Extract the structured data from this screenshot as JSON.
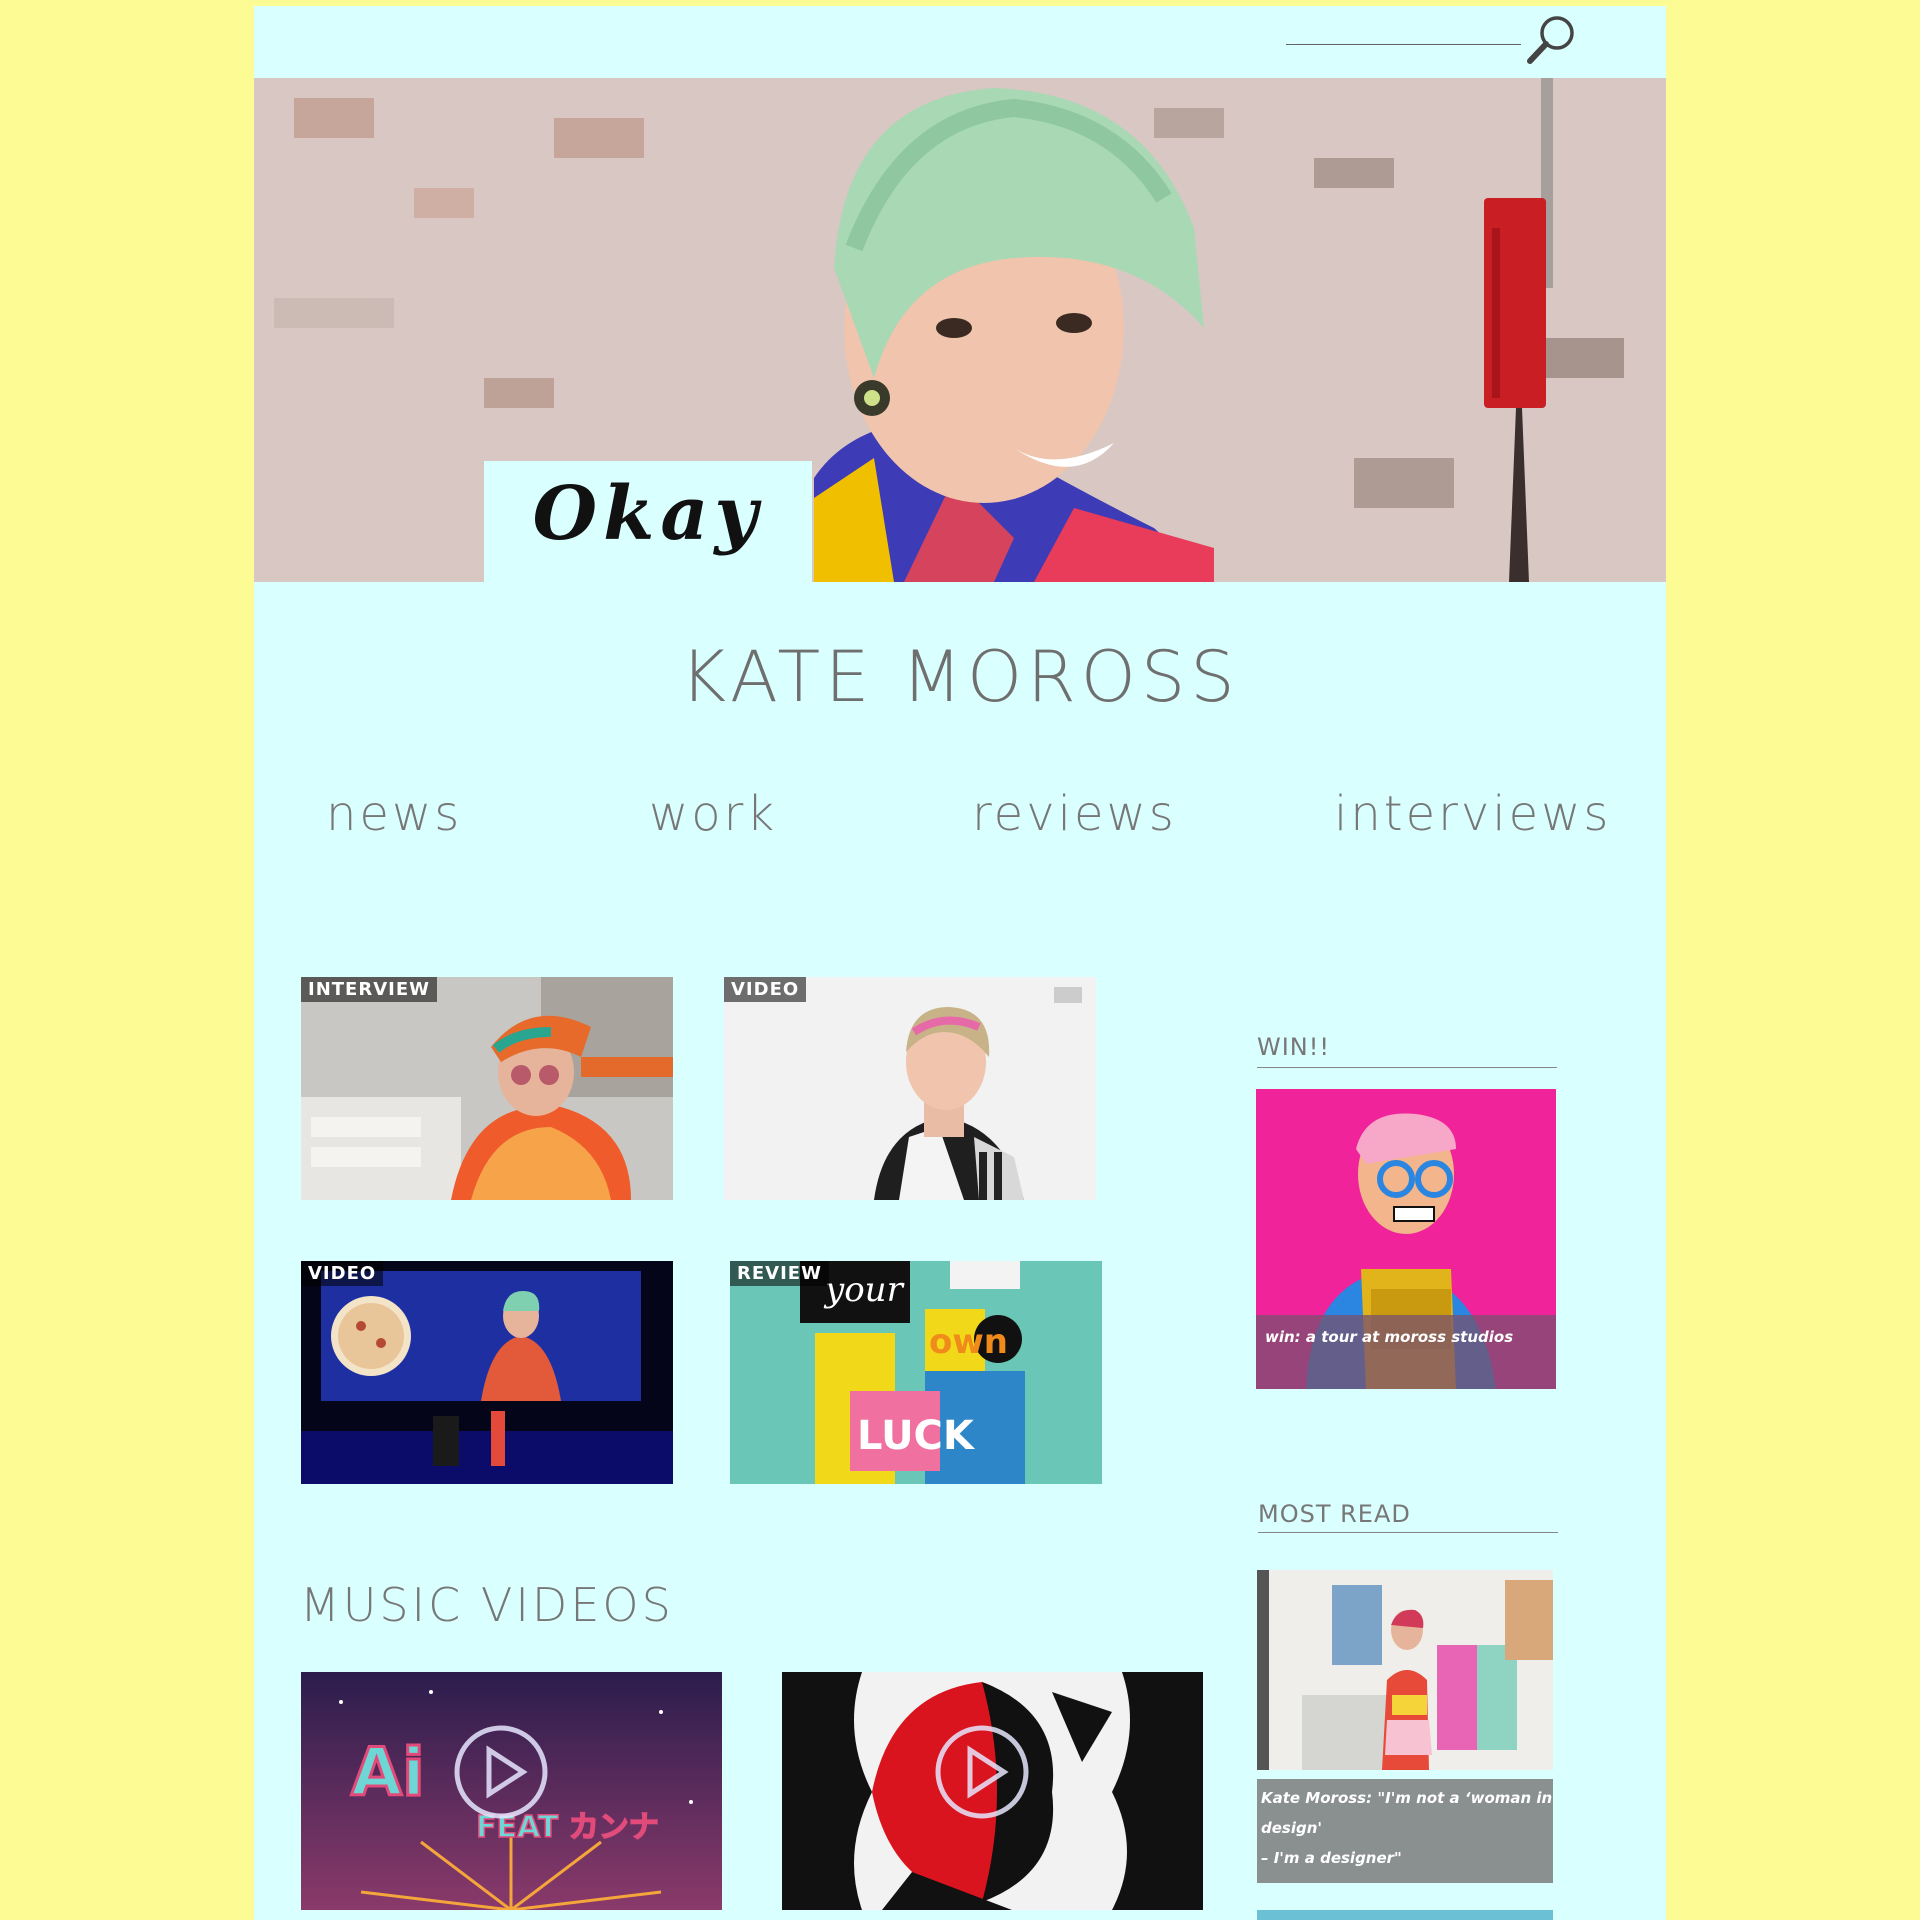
{
  "search": {
    "placeholder": ""
  },
  "hero": {
    "logo": "Okay"
  },
  "site": {
    "title": "KATE MOROSS"
  },
  "nav": {
    "items": [
      {
        "label": "news"
      },
      {
        "label": "work"
      },
      {
        "label": "reviews"
      },
      {
        "label": "interviews"
      }
    ]
  },
  "grid": {
    "items": [
      {
        "tag": "INTERVIEW"
      },
      {
        "tag": "VIDEO"
      },
      {
        "tag": "VIDEO"
      },
      {
        "tag": "REVIEW"
      }
    ]
  },
  "sidebar": {
    "win": {
      "heading": "WIN!!",
      "caption": "win: a tour at moross studios"
    },
    "most_read": {
      "heading": "MOST READ",
      "caption_line1": "Kate Moross: \"I'm not a ‘woman in",
      "caption_line2": "design'",
      "caption_line3": "– I'm a designer\""
    }
  },
  "music": {
    "title": "MUSIC VIDEOS",
    "video1_text": "Ai",
    "video1_sub": "FEAT カンナ"
  },
  "colors": {
    "page_bg": "#fdfb93",
    "content_bg": "#d9ffff",
    "text_gray": "#777777",
    "win_pink": "#f0239a"
  }
}
